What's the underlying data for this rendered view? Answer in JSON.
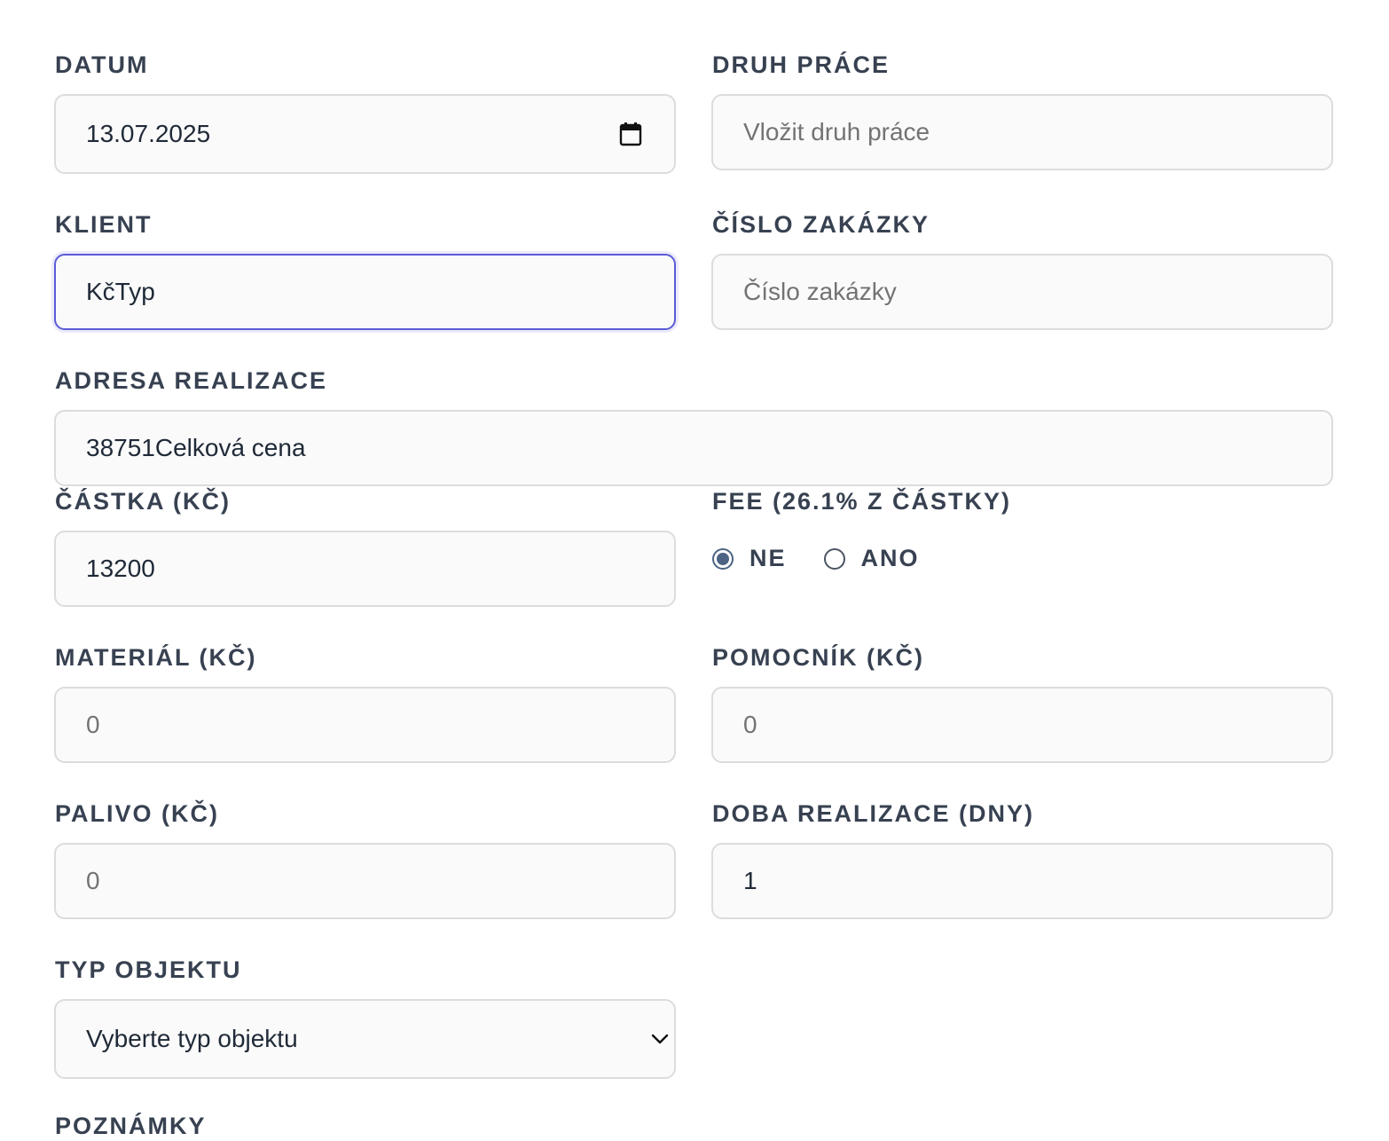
{
  "form": {
    "datum": {
      "label": "DATUM",
      "value": "13.07.2025"
    },
    "druh_prace": {
      "label": "DRUH PRÁCE",
      "placeholder": "Vložit druh práce"
    },
    "klient": {
      "label": "KLIENT",
      "value": "KčTyp"
    },
    "cislo_zakazky": {
      "label": "ČÍSLO ZAKÁZKY",
      "placeholder": "Číslo zakázky"
    },
    "adresa_realizace": {
      "label": "ADRESA REALIZACE",
      "value": "38751Celková cena"
    },
    "castka": {
      "label": "ČÁSTKA (KČ)",
      "value": "13200"
    },
    "fee": {
      "label": "FEE (26.1% Z ČÁSTKY)",
      "options": [
        "NE",
        "ANO"
      ],
      "selected": "NE"
    },
    "material": {
      "label": "MATERIÁL (KČ)",
      "placeholder": "0"
    },
    "pomocnik": {
      "label": "POMOCNÍK (KČ)",
      "placeholder": "0"
    },
    "palivo": {
      "label": "PALIVO (KČ)",
      "placeholder": "0"
    },
    "doba_realizace": {
      "label": "DOBA REALIZACE (DNY)",
      "value": "1"
    },
    "typ_objektu": {
      "label": "TYP OBJEKTU",
      "selected_value": "Vyberte typ objektu"
    },
    "poznamky": {
      "label": "POZNÁMKY"
    }
  },
  "icons": {
    "date": "calendar-icon",
    "select": "chevron-down-icon"
  },
  "colors": {
    "focus_border": "#5b5bd6",
    "radio_checked": "#4c6384",
    "label_text": "#374151",
    "field_bg": "#fafafa",
    "field_border": "#dcdcdc",
    "placeholder_text": "#737373"
  }
}
